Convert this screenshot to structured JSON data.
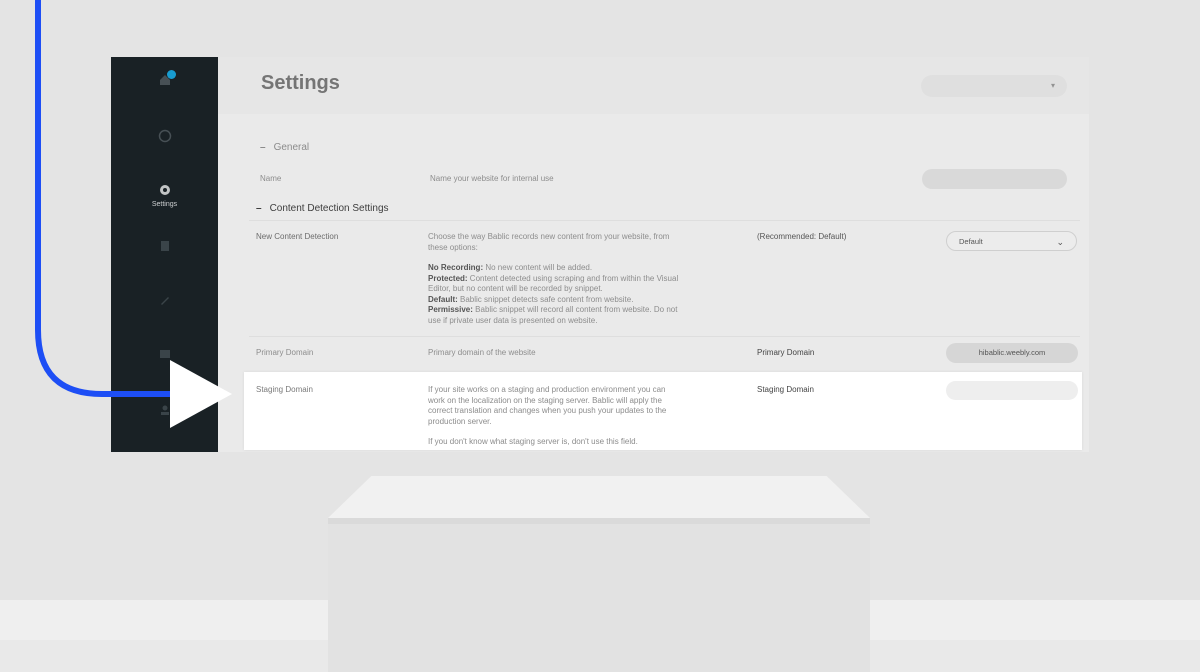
{
  "sidebar": {
    "items": [
      {
        "label": "",
        "icon": "home-icon"
      },
      {
        "label": "",
        "icon": "globe-icon"
      },
      {
        "label": "Settings",
        "icon": "gear-icon"
      },
      {
        "label": "",
        "icon": "file-icon"
      },
      {
        "label": "",
        "icon": "pencil-icon"
      },
      {
        "label": "",
        "icon": "image-icon"
      },
      {
        "label": "",
        "icon": "user-icon"
      }
    ]
  },
  "header": {
    "title": "Settings",
    "site_select_value": "",
    "site_select_icon": "chevron-down-icon"
  },
  "general": {
    "title": "General",
    "name_label": "Name",
    "name_help": "Name your website for internal use",
    "name_value": ""
  },
  "content_detection": {
    "title": "Content Detection Settings",
    "new_content": {
      "label": "New Content Detection",
      "intro": "Choose the way Bablic records new content from your website, from these options:",
      "options": [
        {
          "name": "No Recording:",
          "text": "No new content will be added."
        },
        {
          "name": "Protected:",
          "text": "Content detected using scraping and from within the Visual Editor, but no content will be recorded by snippet."
        },
        {
          "name": "Default:",
          "text": "Bablic snippet detects safe content from website."
        },
        {
          "name": "Permissive:",
          "text": "Bablic snippet will record all content from website. Do not use if private user data is presented on website."
        }
      ],
      "recommendation": "(Recommended: Default)",
      "select_value": "Default"
    },
    "primary_domain": {
      "label": "Primary Domain",
      "help": "Primary domain of the website",
      "field_label": "Primary Domain",
      "value": "hibablic.weebly.com"
    },
    "staging_domain": {
      "label": "Staging Domain",
      "help": "If your site works on a staging and production environment you can work on the localization on the staging server. Bablic will apply the correct translation and changes when you push your updates to the production server.",
      "help2": "If you don't know what staging server is, don't use this field.",
      "field_label": "Staging Domain",
      "value": ""
    }
  },
  "colors": {
    "connector": "#1d4ef5",
    "sidebar": "#1b2327",
    "accent": "#1aa3d9"
  }
}
